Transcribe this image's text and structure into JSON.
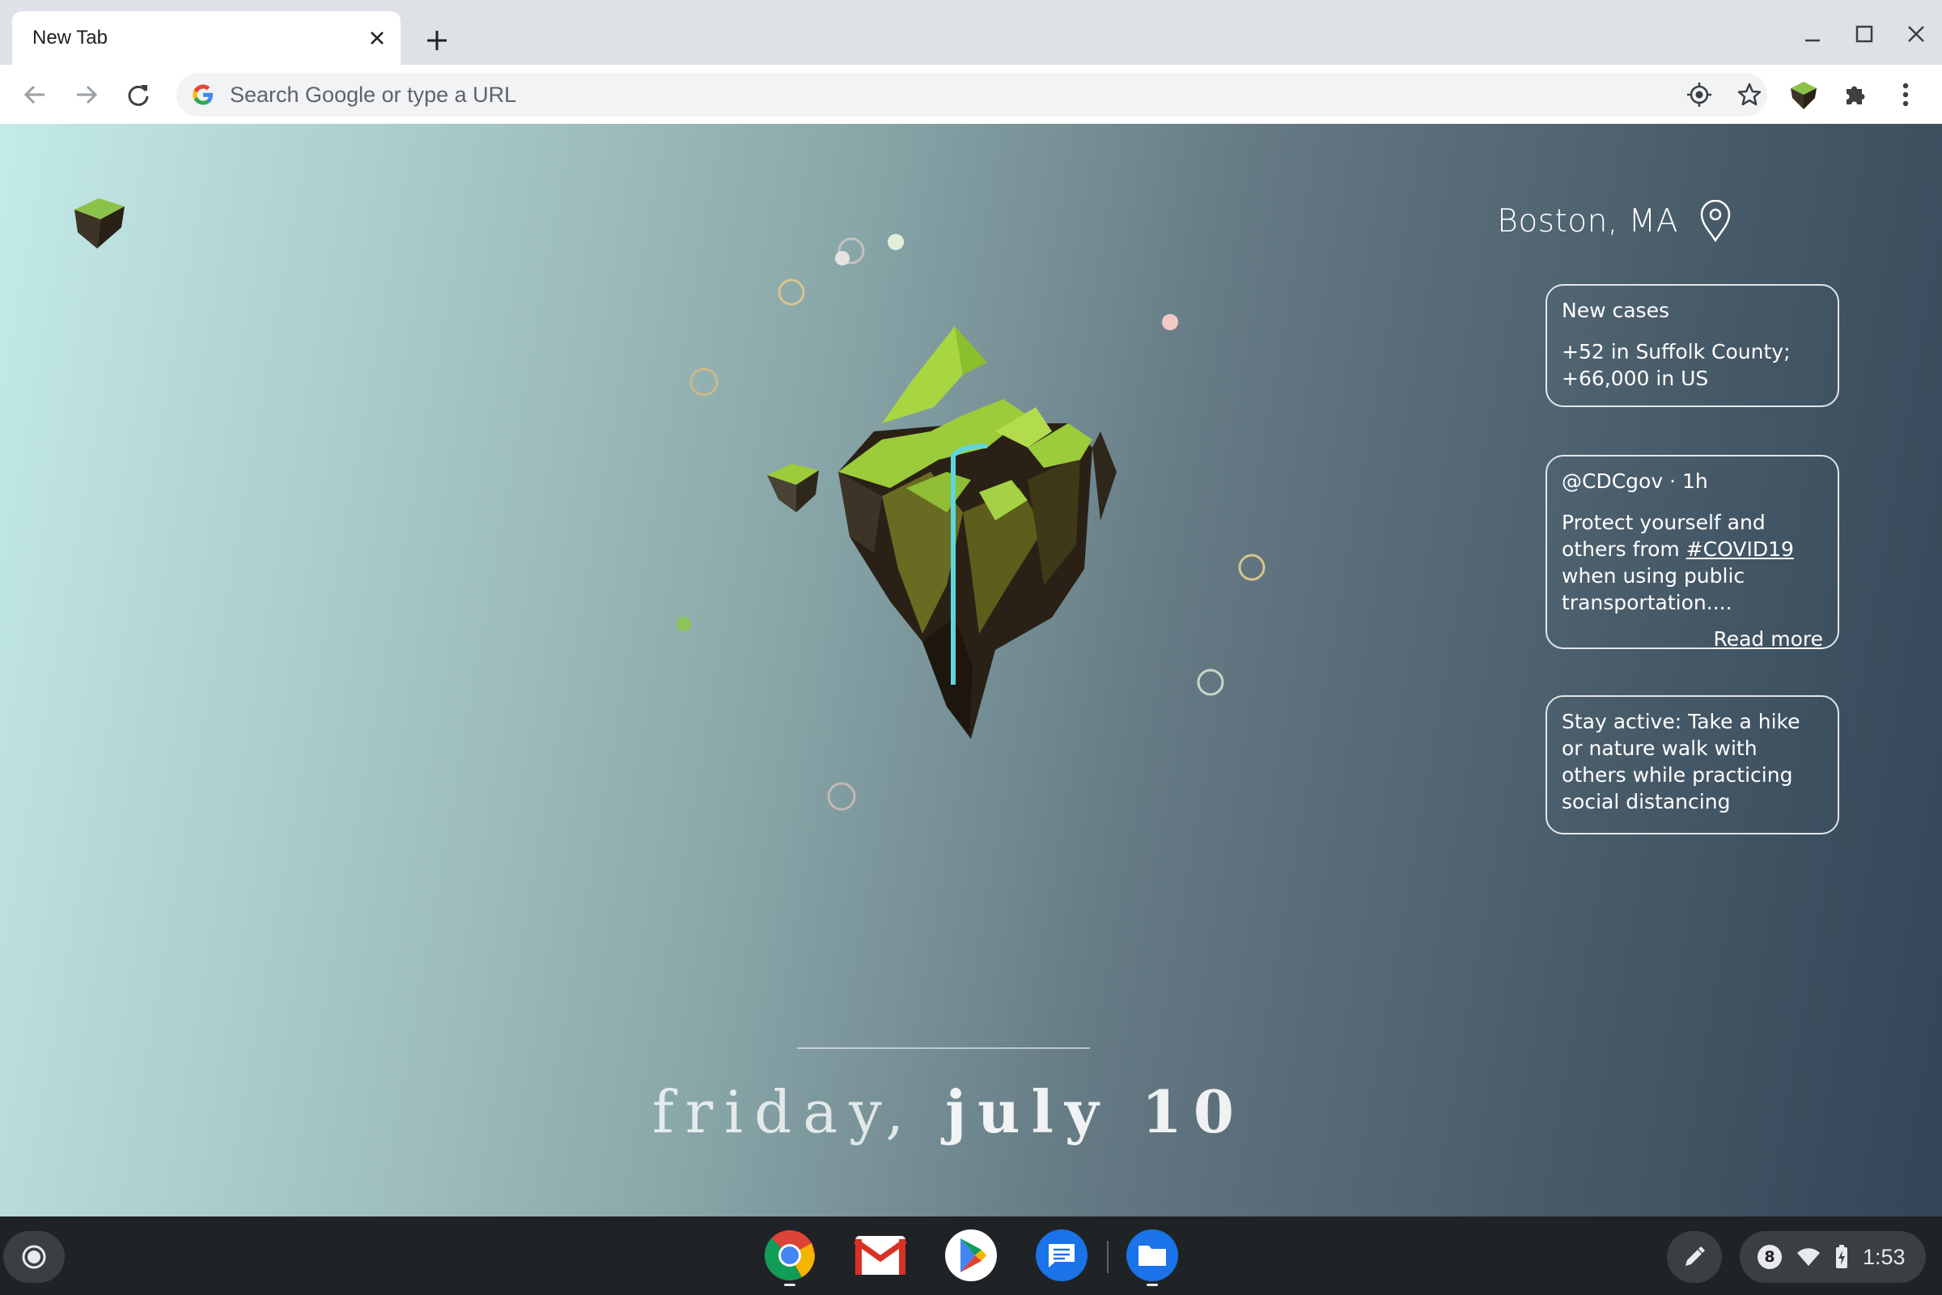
{
  "browser": {
    "tab": {
      "title": "New Tab"
    },
    "omnibox": {
      "placeholder": "Search Google or type a URL"
    }
  },
  "page": {
    "location": "Boston, MA",
    "cards": [
      {
        "title": "New cases",
        "line1": "+52 in Suffolk County;",
        "line2": "+66,000 in US"
      },
      {
        "handle": "@CDCgov",
        "time": "· 1h",
        "text_before": "Protect yourself and others from",
        "hashtag": "#COVID19",
        "text_after": " when using public transportation....",
        "link": "Read more"
      },
      {
        "text": "Stay active: Take a hike or nature walk with others while practicing social distancing"
      }
    ],
    "date": {
      "weekday": "friday,",
      "day": "july 10"
    }
  },
  "shelf": {
    "apps": [
      "chrome-icon",
      "gmail-icon",
      "play-store-icon",
      "messages-icon",
      "files-icon"
    ],
    "notification_count": "8",
    "time": "1:53"
  },
  "colors": {
    "island_green": "#9ccb3b",
    "island_dark": "#2a2116",
    "waterfall": "#5fd6dc"
  }
}
